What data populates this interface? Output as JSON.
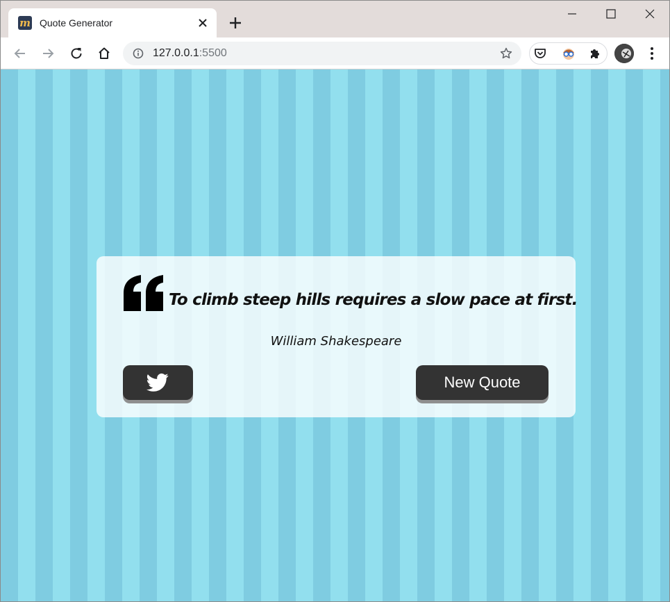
{
  "browser": {
    "tab_title": "Quote Generator",
    "favicon_letter": "m",
    "url_host": "127.0.0.1",
    "url_port": ":5500"
  },
  "quote": {
    "text": "To climb steep hills requires a slow pace at first.",
    "author": "William Shakespeare"
  },
  "buttons": {
    "new_quote": "New Quote",
    "tweet_icon": "twitter-icon"
  },
  "colors": {
    "stripe_dark": "#7fcce1",
    "stripe_light": "#92dfee",
    "button_bg": "#333333",
    "card_bg": "rgba(255,255,255,0.8)"
  }
}
